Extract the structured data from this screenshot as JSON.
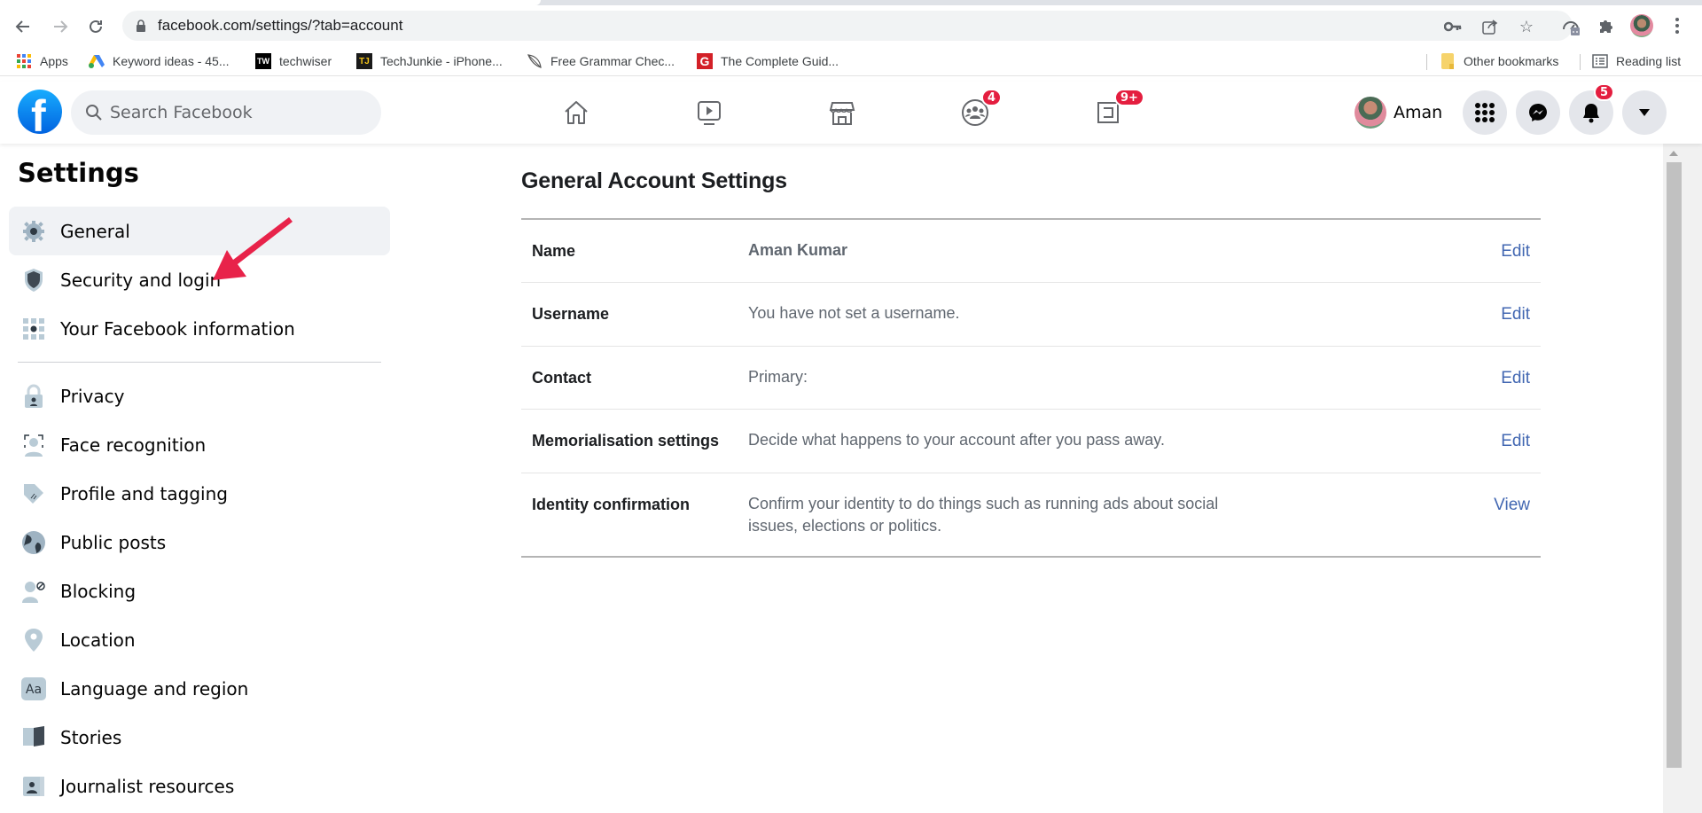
{
  "browser": {
    "url": "facebook.com/settings/?tab=account",
    "nav": {
      "back": "back-arrow",
      "forward": "forward-arrow",
      "reload": "reload"
    },
    "bookmarks": [
      {
        "label": "Apps",
        "icon": "apps-grid-icon"
      },
      {
        "label": "Keyword ideas - 45...",
        "icon": "google-ads-icon"
      },
      {
        "label": "techwiser",
        "icon": "tw-icon",
        "icon_text": "TW"
      },
      {
        "label": "TechJunkie - iPhone...",
        "icon": "tj-icon",
        "icon_text": "TJ"
      },
      {
        "label": "Free Grammar Chec...",
        "icon": "quill-icon"
      },
      {
        "label": "The Complete Guid...",
        "icon": "g-icon",
        "icon_text": "G"
      }
    ],
    "other_bookmarks": "Other bookmarks",
    "reading_list": "Reading list"
  },
  "header": {
    "search_placeholder": "Search Facebook",
    "nav": [
      {
        "name": "home",
        "badge": ""
      },
      {
        "name": "watch",
        "badge": ""
      },
      {
        "name": "marketplace",
        "badge": ""
      },
      {
        "name": "groups",
        "badge": "4"
      },
      {
        "name": "gaming",
        "badge": "9+"
      }
    ],
    "profile_name": "Aman",
    "notifications_badge": "5"
  },
  "sidebar": {
    "title": "Settings",
    "items": [
      {
        "label": "General",
        "icon": "gear-icon",
        "active": true
      },
      {
        "label": "Security and login",
        "icon": "shield-icon"
      },
      {
        "label": "Your Facebook information",
        "icon": "grid-info-icon"
      },
      {
        "label": "Privacy",
        "icon": "lock-person-icon"
      },
      {
        "label": "Face recognition",
        "icon": "face-scan-icon"
      },
      {
        "label": "Profile and tagging",
        "icon": "tag-icon"
      },
      {
        "label": "Public posts",
        "icon": "globe-icon"
      },
      {
        "label": "Blocking",
        "icon": "blocked-person-icon"
      },
      {
        "label": "Location",
        "icon": "location-pin-icon"
      },
      {
        "label": "Language and region",
        "icon": "language-aa-icon"
      },
      {
        "label": "Stories",
        "icon": "book-icon"
      },
      {
        "label": "Journalist resources",
        "icon": "id-card-icon"
      }
    ]
  },
  "main": {
    "title": "General Account Settings",
    "rows": [
      {
        "label": "Name",
        "value": "Aman Kumar",
        "action": "Edit"
      },
      {
        "label": "Username",
        "value": "You have not set a username.",
        "action": "Edit"
      },
      {
        "label": "Contact",
        "value": "Primary:",
        "action": "Edit"
      },
      {
        "label": "Memorialisation settings",
        "value": "Decide what happens to your account after you pass away.",
        "action": "Edit"
      },
      {
        "label": "Identity confirmation",
        "value": "Confirm your identity to do things such as running ads about social issues, elections or politics.",
        "action": "View"
      }
    ]
  },
  "colors": {
    "fb_blue": "#1877f2",
    "link_blue": "#4267b2",
    "badge_red": "#e41e3f",
    "annotation_arrow": "#e8234a"
  }
}
